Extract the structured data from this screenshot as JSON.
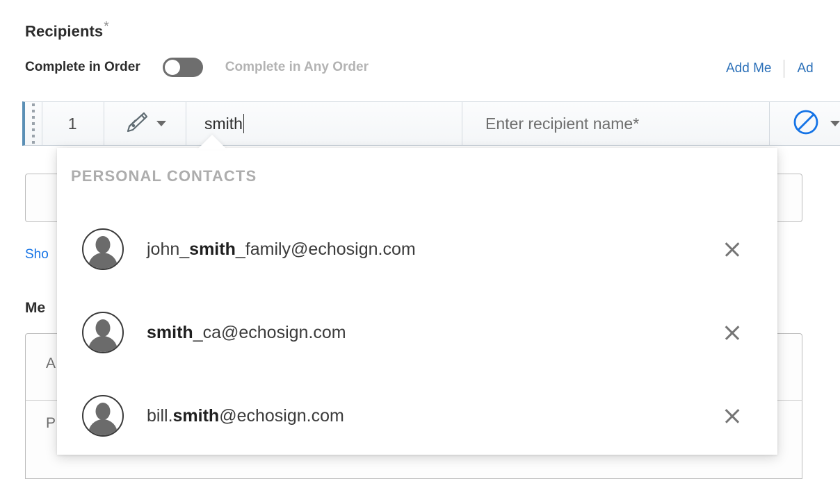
{
  "section": {
    "title": "Recipients",
    "required_mark": "*"
  },
  "order": {
    "label_in_order": "Complete in Order",
    "label_any_order": "Complete in Any Order",
    "toggle_state": "off",
    "toggle_name": "complete-order-toggle"
  },
  "header_links": {
    "add_me": "Add Me",
    "add_second": "Ad"
  },
  "recipient_row": {
    "index": "1",
    "role_icon": "signature-pen-icon",
    "email_value": "smith",
    "name_placeholder": "Enter recipient name*",
    "auth_icon": "no-authentication-icon",
    "accent_color": "#5a8fb5",
    "auth_icon_color": "#1473e6"
  },
  "dropdown": {
    "header": "PERSONAL CONTACTS",
    "contacts": [
      {
        "prefix": "john_",
        "match": "smith",
        "suffix": "_family@echosign.com",
        "remove_label": "×"
      },
      {
        "prefix": "",
        "match": "smith",
        "suffix": "_ca@echosign.com",
        "remove_label": "×"
      },
      {
        "prefix": "bill.",
        "match": "smith",
        "suffix": "@echosign.com",
        "remove_label": "×"
      }
    ]
  },
  "background": {
    "link_text": "Sho",
    "heading": "Me",
    "field_1": "A",
    "field_2": "P"
  }
}
